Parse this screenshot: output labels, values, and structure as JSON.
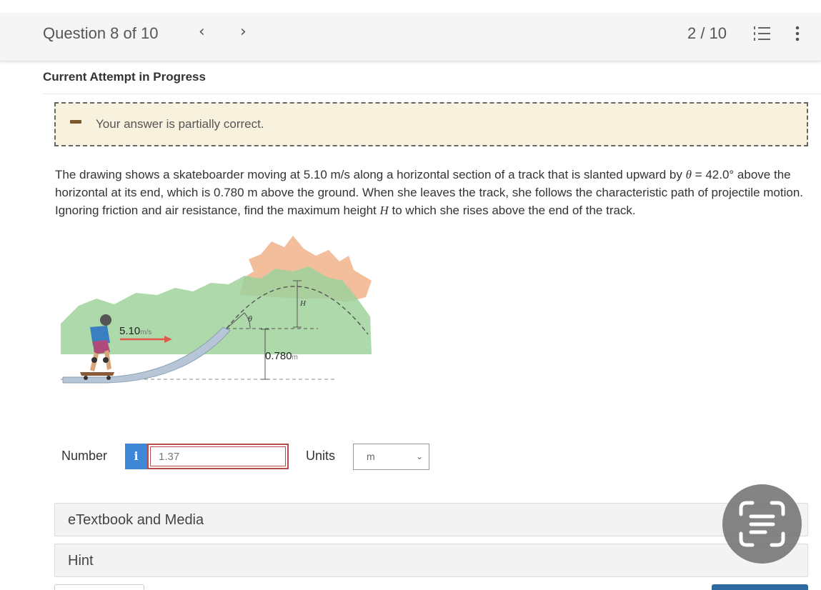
{
  "header": {
    "question_label": "Question 8 of 10",
    "prev_icon": "chevron-left-icon",
    "next_icon": "chevron-right-icon",
    "page_counter": "2 / 10",
    "list_icon": "numbered-list-icon",
    "more_icon": "vertical-dots-icon"
  },
  "attempt_status": "Current Attempt in Progress",
  "feedback": {
    "icon": "partial-dash-icon",
    "message": "Your answer is partially correct."
  },
  "question": {
    "text_1": "The drawing shows a skateboarder moving at 5.10 m/s along a horizontal section of a track that is slanted upward by ",
    "theta": "θ",
    "text_2": " = 42.0° above the horizontal at its end, which is 0.780 m above the ground. When she leaves the track, she follows the characteristic path of projectile motion. Ignoring friction and air resistance, find the maximum height ",
    "H": "H",
    "text_3": " to which she rises above the end of the track."
  },
  "figure": {
    "speed_value": "5.10",
    "speed_unit": "m/s",
    "height_value": "0.780",
    "height_unit": "m",
    "theta_label": "θ",
    "H_label": "H"
  },
  "answer": {
    "number_label": "Number",
    "info_icon": "info-icon",
    "info_glyph": "i",
    "number_value": "1.37",
    "units_label": "Units",
    "units_value": "m"
  },
  "panels": {
    "etextbook": "eTextbook and Media",
    "hint": "Hint"
  },
  "overlay": {
    "scan_icon": "text-scan-icon"
  },
  "colors": {
    "feedback_bg": "#f8f1de",
    "info_button": "#3d87d6",
    "input_error_border": "#b94a48",
    "submit_button": "#2c6aa0"
  }
}
